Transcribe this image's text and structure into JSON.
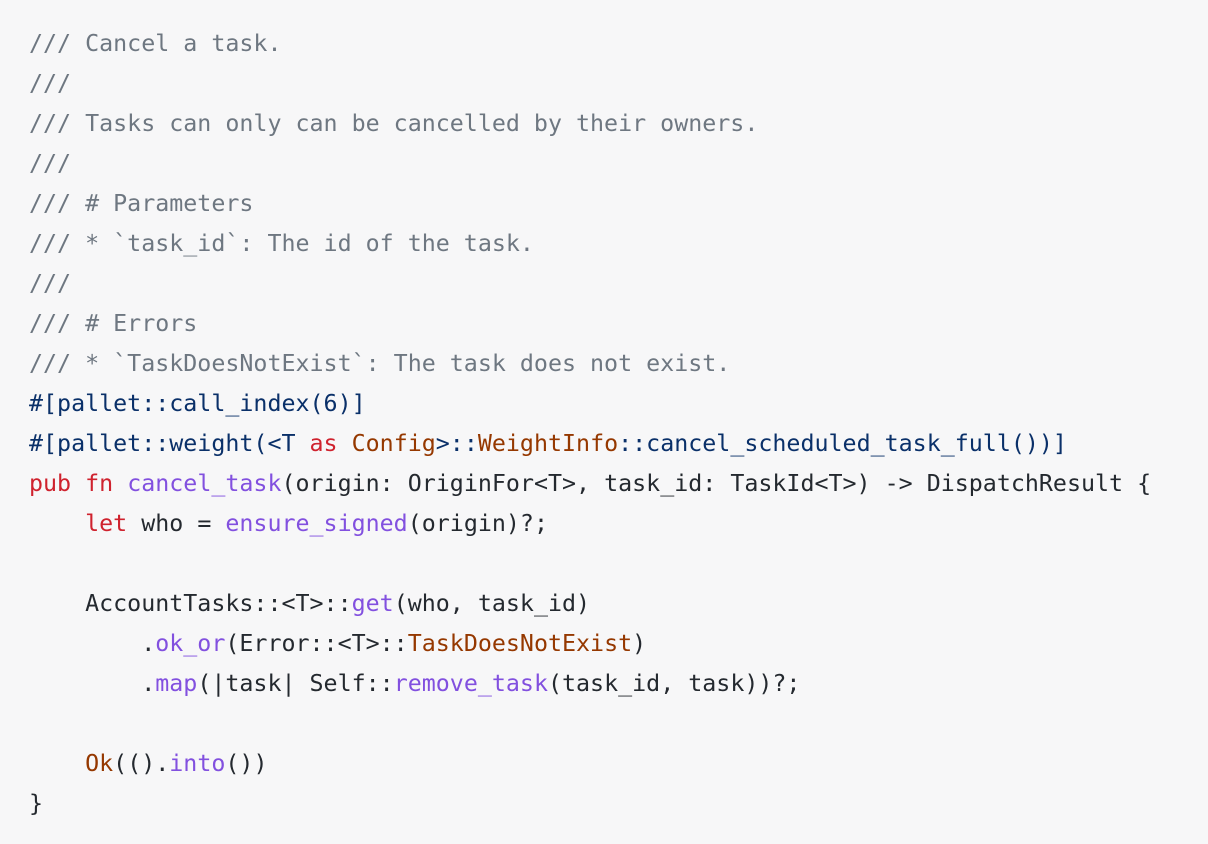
{
  "colors": {
    "background": "#f7f7f8",
    "text": "#24292f",
    "comment": "#6e7781",
    "attribute": "#0a3069",
    "keyword": "#cf222e",
    "function": "#8250df",
    "type": "#953800"
  },
  "code": {
    "language": "rust",
    "lines": [
      [
        {
          "t": "/// Cancel a task.",
          "k": "comment"
        }
      ],
      [
        {
          "t": "///",
          "k": "comment"
        }
      ],
      [
        {
          "t": "/// Tasks can only can be cancelled by their owners.",
          "k": "comment"
        }
      ],
      [
        {
          "t": "///",
          "k": "comment"
        }
      ],
      [
        {
          "t": "/// # Parameters",
          "k": "comment"
        }
      ],
      [
        {
          "t": "/// * `task_id`: The id of the task.",
          "k": "comment"
        }
      ],
      [
        {
          "t": "///",
          "k": "comment"
        }
      ],
      [
        {
          "t": "/// # Errors",
          "k": "comment"
        }
      ],
      [
        {
          "t": "/// * `TaskDoesNotExist`: The task does not exist.",
          "k": "comment"
        }
      ],
      [
        {
          "t": "#[pallet::call_index(6)]",
          "k": "attr"
        }
      ],
      [
        {
          "t": "#[pallet::weight(<T ",
          "k": "attr"
        },
        {
          "t": "as",
          "k": "keyword"
        },
        {
          "t": " ",
          "k": "attr"
        },
        {
          "t": "Config",
          "k": "type"
        },
        {
          "t": ">::",
          "k": "attr"
        },
        {
          "t": "WeightInfo",
          "k": "type"
        },
        {
          "t": "::cancel_scheduled_task_full())]",
          "k": "attr"
        }
      ],
      [
        {
          "t": "pub",
          "k": "keyword"
        },
        {
          "t": " ",
          "k": "default"
        },
        {
          "t": "fn",
          "k": "keyword"
        },
        {
          "t": " ",
          "k": "default"
        },
        {
          "t": "cancel_task",
          "k": "func"
        },
        {
          "t": "(origin: OriginFor<T>, task_id: TaskId<T>) -> DispatchResult {",
          "k": "default"
        }
      ],
      [
        {
          "t": "    ",
          "k": "default"
        },
        {
          "t": "let",
          "k": "keyword"
        },
        {
          "t": " who = ",
          "k": "default"
        },
        {
          "t": "ensure_signed",
          "k": "func"
        },
        {
          "t": "(origin)?;",
          "k": "default"
        }
      ],
      [
        {
          "t": "",
          "k": "default"
        }
      ],
      [
        {
          "t": "    AccountTasks::<T>::",
          "k": "default"
        },
        {
          "t": "get",
          "k": "func"
        },
        {
          "t": "(who, task_id)",
          "k": "default"
        }
      ],
      [
        {
          "t": "        .",
          "k": "default"
        },
        {
          "t": "ok_or",
          "k": "func"
        },
        {
          "t": "(Error::<T>::",
          "k": "default"
        },
        {
          "t": "TaskDoesNotExist",
          "k": "type"
        },
        {
          "t": ")",
          "k": "default"
        }
      ],
      [
        {
          "t": "        .",
          "k": "default"
        },
        {
          "t": "map",
          "k": "func"
        },
        {
          "t": "(|task| Self::",
          "k": "default"
        },
        {
          "t": "remove_task",
          "k": "func"
        },
        {
          "t": "(task_id, task))?;",
          "k": "default"
        }
      ],
      [
        {
          "t": "",
          "k": "default"
        }
      ],
      [
        {
          "t": "    ",
          "k": "default"
        },
        {
          "t": "Ok",
          "k": "type"
        },
        {
          "t": "(().",
          "k": "default"
        },
        {
          "t": "into",
          "k": "func"
        },
        {
          "t": "())",
          "k": "default"
        }
      ],
      [
        {
          "t": "}",
          "k": "default"
        }
      ]
    ]
  }
}
